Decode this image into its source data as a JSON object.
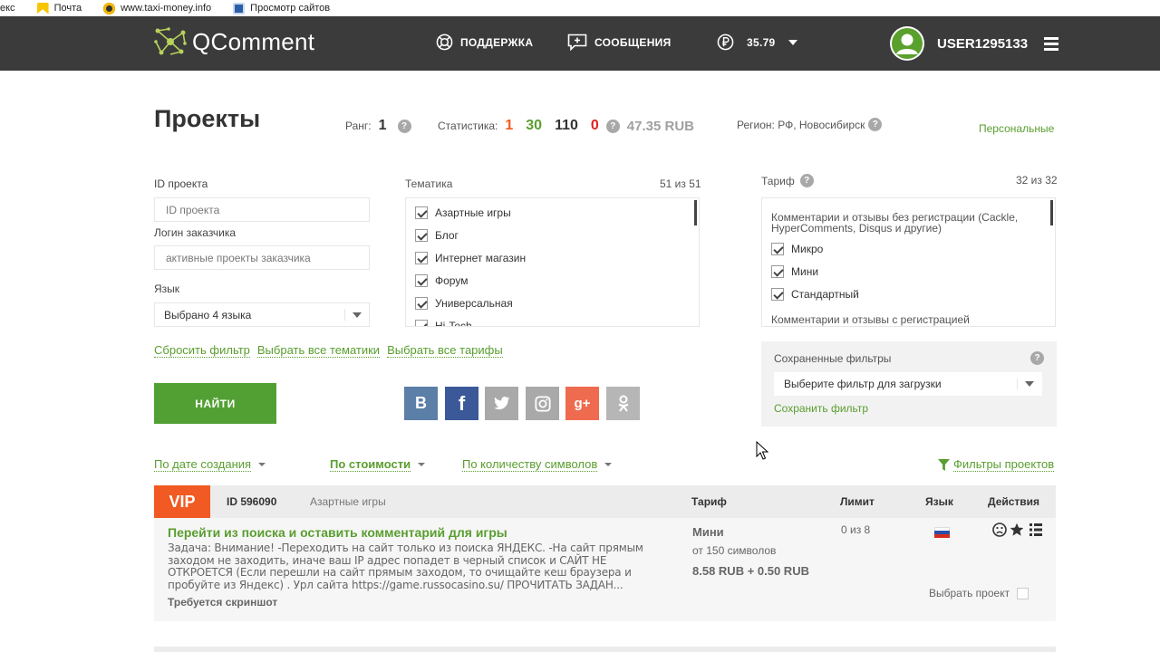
{
  "bookmarks": [
    {
      "label": "екс",
      "icon": "yandex-icon"
    },
    {
      "label": "Почта",
      "icon": "mail-icon"
    },
    {
      "label": "www.taxi-money.info",
      "icon": "taxi-icon"
    },
    {
      "label": "Просмотр сайтов",
      "icon": "bookmark-page-icon"
    }
  ],
  "header": {
    "logo": "QComment",
    "support": "ПОДДЕРЖКА",
    "messages": "СООБЩЕНИЯ",
    "balance": "35.79",
    "username": "USER1295133"
  },
  "page": {
    "title": "Проекты",
    "rank_label": "Ранг:",
    "rank_value": "1",
    "stats_label": "Статистика:",
    "stats": [
      "1",
      "30",
      "110",
      "0"
    ],
    "stats_colors": [
      "#f15a22",
      "#5a9e2f",
      "#333333",
      "#e02020"
    ],
    "stats_amount": "47.35 RUB",
    "region": "Регион: РФ, Новосибирск",
    "personal_link": "Персональные"
  },
  "filters": {
    "project_id_label": "ID проекта",
    "project_id_placeholder": "ID проекта",
    "customer_label": "Логин заказчика",
    "customer_placeholder": "активные проекты заказчика",
    "language_label": "Язык",
    "language_value": "Выбрано 4 языка",
    "topic_label": "Тематика",
    "topic_count": "51 из 51",
    "topics": [
      "Азартные игры",
      "Блог",
      "Интернет магазин",
      "Форум",
      "Универсальная",
      "Hi-Tech"
    ],
    "tariff_label": "Тариф",
    "tariff_count": "32 из 32",
    "tariff_group1": "Комментарии и отзывы без регистрации (Cackle, HyperComments, Disqus и другие)",
    "tariffs": [
      "Микро",
      "Мини",
      "Стандартный"
    ],
    "tariff_group2": "Комментарии и отзывы с регистрацией",
    "reset_link": "Сбросить фильтр",
    "select_topics_link": "Выбрать все тематики",
    "select_tariffs_link": "Выбрать все тарифы",
    "find_button": "НАЙТИ",
    "saved_filters_label": "Сохраненные фильтры",
    "saved_filters_select": "Выберите фильтр для загрузки",
    "save_filter_link": "Сохранить фильтр"
  },
  "social": [
    {
      "name": "vk",
      "glyph": "B",
      "color": "#5b7fa6"
    },
    {
      "name": "facebook",
      "glyph": "f",
      "color": "#3b5998"
    },
    {
      "name": "twitter",
      "glyph": "t",
      "color": "#a9a9a9"
    },
    {
      "name": "instagram",
      "glyph": "◻",
      "color": "#a9a9a9"
    },
    {
      "name": "google-plus",
      "glyph": "g+",
      "color": "#ef6b4f"
    },
    {
      "name": "odnoklassniki",
      "glyph": "ok",
      "color": "#b6b6b6"
    }
  ],
  "sort": {
    "by_date": "По дате создания",
    "by_price": "По стоимости",
    "by_chars": "По количеству символов",
    "project_filters": "Фильтры проектов"
  },
  "project": {
    "badge": "VIP",
    "id": "ID 596090",
    "topic": "Азартные игры",
    "col_tariff": "Тариф",
    "col_limit": "Лимит",
    "col_lang": "Язык",
    "col_actions": "Действия",
    "title": "Перейти из поиска и оставить комментарий для игры",
    "description": "Задача: Внимание! -Переходить на сайт только из поиска ЯНДЕКС. -На сайт прямым заходом не заходить, иначе ваш IP адрес попадет в черный список и САЙТ НЕ ОТКРОЕТСЯ (Если перешли на сайт прямым заходом, то очищайте кеш браузера и пробуйте из Яндекс) . Урл сайта https://game.russocasino.su/ ПРОЧИТАТЬ ЗАДАН...",
    "screenshot_required": "Требуется скриншот",
    "tariff_name": "Мини",
    "tariff_chars": "от 150 символов",
    "price": "8.58 RUB + 0.50 RUB",
    "limit": "0 из 8",
    "select_label": "Выбрать проект"
  }
}
